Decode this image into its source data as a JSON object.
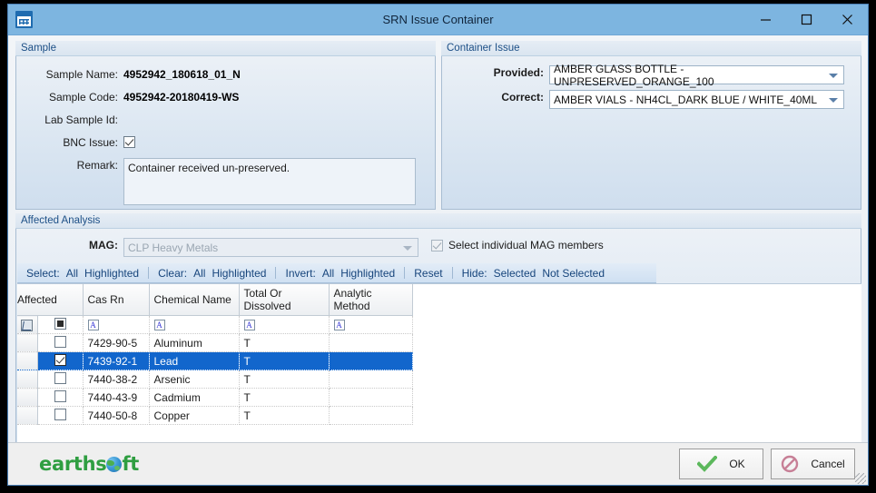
{
  "window": {
    "title": "SRN Issue Container",
    "icon": "calendar-grid-icon",
    "minimize_label": "—",
    "maximize_label": "☐",
    "close_label": "✕"
  },
  "sample": {
    "caption": "Sample",
    "fields": [
      {
        "label": "Sample Name:",
        "value": "4952942_180618_01_N"
      },
      {
        "label": "Sample Code:",
        "value": "4952942-20180419-WS"
      },
      {
        "label": "Lab Sample Id:",
        "value": ""
      }
    ],
    "bnc_issue": {
      "label": "BNC Issue:",
      "checked": true
    },
    "remark": {
      "label": "Remark:",
      "value": "Container received un-preserved."
    }
  },
  "container_issue": {
    "caption": "Container Issue",
    "provided": {
      "label": "Provided:",
      "value": "AMBER GLASS BOTTLE - UNPRESERVED_ORANGE_100"
    },
    "correct": {
      "label": "Correct:",
      "value": "AMBER VIALS - NH4CL_DARK BLUE / WHITE_40ML"
    }
  },
  "affected_analysis": {
    "caption": "Affected Analysis",
    "mag": {
      "label": "MAG:",
      "value": "CLP Heavy Metals",
      "enabled": false
    },
    "select_members": {
      "label": "Select individual MAG members",
      "checked": true,
      "enabled": false
    },
    "toolbar": {
      "select_label": "Select:",
      "select_all": "All",
      "select_highlighted": "Highlighted",
      "clear_label": "Clear:",
      "clear_all": "All",
      "clear_highlighted": "Highlighted",
      "invert_label": "Invert:",
      "invert_all": "All",
      "invert_highlighted": "Highlighted",
      "reset": "Reset",
      "hide_label": "Hide:",
      "hide_selected": "Selected",
      "hide_not_selected": "Not Selected"
    },
    "grid": {
      "columns": [
        "Affected",
        "Cas Rn",
        "Chemical Name",
        "Total Or Dissolved",
        "Analytic Method"
      ],
      "filter_glyph": "A",
      "rows": [
        {
          "affected": false,
          "cas_rn": "7429-90-5",
          "chemical_name": "Aluminum",
          "total_or_dissolved": "T",
          "analytic_method": "",
          "selected": false
        },
        {
          "affected": true,
          "cas_rn": "7439-92-1",
          "chemical_name": "Lead",
          "total_or_dissolved": "T",
          "analytic_method": "",
          "selected": true
        },
        {
          "affected": false,
          "cas_rn": "7440-38-2",
          "chemical_name": "Arsenic",
          "total_or_dissolved": "T",
          "analytic_method": "",
          "selected": false
        },
        {
          "affected": false,
          "cas_rn": "7440-43-9",
          "chemical_name": "Cadmium",
          "total_or_dissolved": "T",
          "analytic_method": "",
          "selected": false
        },
        {
          "affected": false,
          "cas_rn": "7440-50-8",
          "chemical_name": "Copper",
          "total_or_dissolved": "T",
          "analytic_method": "",
          "selected": false
        }
      ]
    }
  },
  "footer": {
    "logo_text_1": "earths",
    "logo_text_2": "ft",
    "ok_label": "OK",
    "cancel_label": "Cancel"
  },
  "colors": {
    "titlebar": "#7db5e0",
    "accent_blue": "#1266cc",
    "caption_text": "#1c4f86",
    "toolbar_link": "#17457c",
    "logo_green": "#2f9e41",
    "ok_check": "#5cb85c",
    "cancel_red": "#c77f96"
  }
}
